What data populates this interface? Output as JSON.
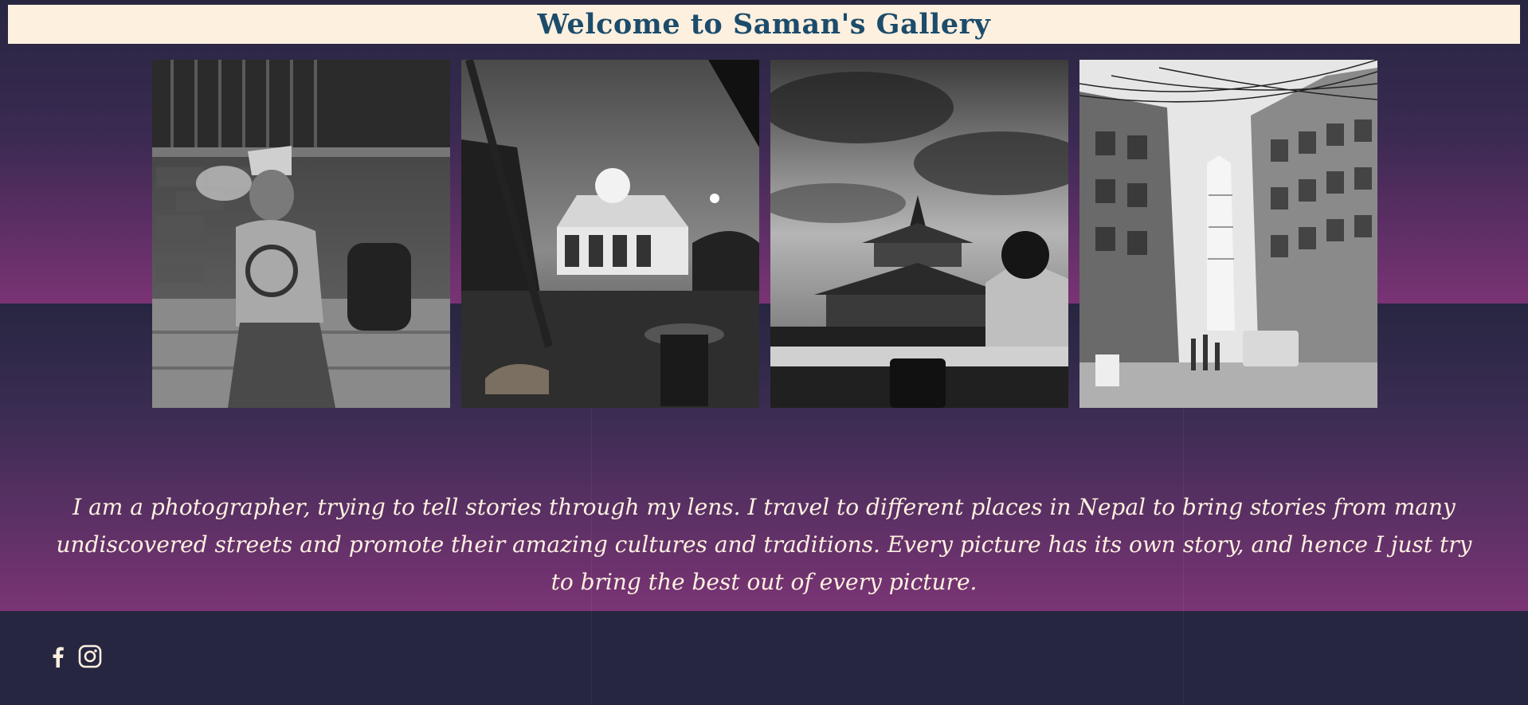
{
  "header": {
    "title": "Welcome to Saman's Gallery"
  },
  "gallery": {
    "photos": [
      {
        "name": "man-smoking-on-steps"
      },
      {
        "name": "temple-courtyard-at-dusk"
      },
      {
        "name": "pagoda-temple-under-clouds"
      },
      {
        "name": "street-with-tower"
      }
    ]
  },
  "bio": {
    "text": "I am a photographer, trying to tell stories through my lens. I travel to different places in Nepal to bring stories from many undiscovered streets and promote their amazing cultures and traditions. Every picture has its own story, and hence I just try to bring the best out of every picture."
  },
  "footer": {
    "social": [
      {
        "icon": "facebook-icon"
      },
      {
        "icon": "instagram-icon"
      }
    ]
  },
  "colors": {
    "header_bg": "#fdf0df",
    "title": "#1c4c6b",
    "page_bg": "#272641",
    "gradient_end": "#7a3475",
    "text": "#fdf0df"
  }
}
